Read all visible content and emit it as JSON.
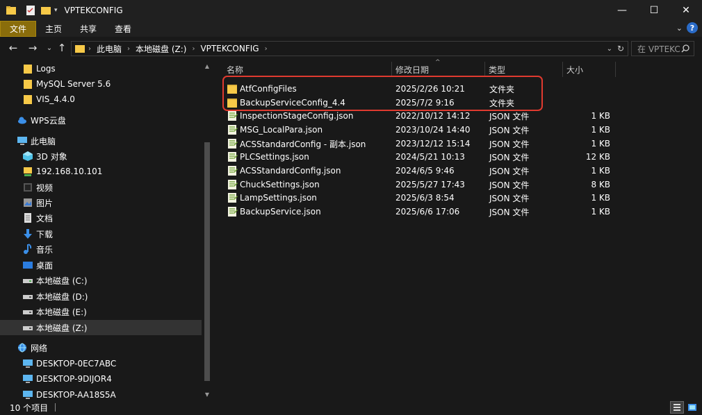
{
  "window": {
    "title": "VPTEKCONFIG",
    "minimize_glyph": "—",
    "maximize_glyph": "☐",
    "close_glyph": "✕"
  },
  "ribbon": {
    "tabs": [
      {
        "label": "文件",
        "active": true
      },
      {
        "label": "主页",
        "active": false
      },
      {
        "label": "共享",
        "active": false
      },
      {
        "label": "查看",
        "active": false
      }
    ],
    "help_glyph": "?"
  },
  "address": {
    "crumbs": [
      "此电脑",
      "本地磁盘 (Z:)",
      "VPTEKCONFIG"
    ],
    "search_placeholder": "在 VPTEKCONFIG 中搜索"
  },
  "sidebar": {
    "items": [
      {
        "label": "Logs",
        "icon": "folder-icon",
        "indent": 1
      },
      {
        "label": "MySQL Server 5.6",
        "icon": "folder-icon",
        "indent": 1
      },
      {
        "label": "VIS_4.4.0",
        "icon": "folder-icon",
        "indent": 1
      },
      {
        "label": "WPS云盘",
        "icon": "cloud-icon",
        "indent": 0
      },
      {
        "label": "此电脑",
        "icon": "pc-icon",
        "indent": 0
      },
      {
        "label": "3D 对象",
        "icon": "cube-icon",
        "indent": 1
      },
      {
        "label": "192.168.10.101",
        "icon": "network-drive-icon",
        "indent": 1
      },
      {
        "label": "视频",
        "icon": "video-icon",
        "indent": 1
      },
      {
        "label": "图片",
        "icon": "picture-icon",
        "indent": 1
      },
      {
        "label": "文档",
        "icon": "document-icon",
        "indent": 1
      },
      {
        "label": "下载",
        "icon": "download-icon",
        "indent": 1
      },
      {
        "label": "音乐",
        "icon": "music-icon",
        "indent": 1
      },
      {
        "label": "桌面",
        "icon": "desktop-icon",
        "indent": 1
      },
      {
        "label": "本地磁盘 (C:)",
        "icon": "drive-icon",
        "indent": 1
      },
      {
        "label": "本地磁盘 (D:)",
        "icon": "drive-icon",
        "indent": 1
      },
      {
        "label": "本地磁盘 (E:)",
        "icon": "drive-icon",
        "indent": 1
      },
      {
        "label": "本地磁盘 (Z:)",
        "icon": "drive-icon",
        "indent": 1,
        "selected": true
      },
      {
        "label": "网络",
        "icon": "network-icon",
        "indent": 0
      },
      {
        "label": "DESKTOP-0EC7ABC",
        "icon": "computer-icon",
        "indent": 1
      },
      {
        "label": "DESKTOP-9DIJOR4",
        "icon": "computer-icon",
        "indent": 1
      },
      {
        "label": "DESKTOP-AA18S5A",
        "icon": "computer-icon",
        "indent": 1
      }
    ]
  },
  "columns": {
    "name": "名称",
    "date": "修改日期",
    "type": "类型",
    "size": "大小"
  },
  "files": [
    {
      "name": "AtfConfigFiles",
      "date": "2025/2/26 10:21",
      "type": "文件夹",
      "size": "",
      "icon": "folder-icon"
    },
    {
      "name": "BackupServiceConfig_4.4",
      "date": "2025/7/2 9:16",
      "type": "文件夹",
      "size": "",
      "icon": "folder-icon"
    },
    {
      "name": "InspectionStageConfig.json",
      "date": "2022/10/12 14:12",
      "type": "JSON 文件",
      "size": "1 KB",
      "icon": "json-file-icon"
    },
    {
      "name": "MSG_LocalPara.json",
      "date": "2023/10/24 14:40",
      "type": "JSON 文件",
      "size": "1 KB",
      "icon": "json-file-icon"
    },
    {
      "name": "ACSStandardConfig - 副本.json",
      "date": "2023/12/12 15:14",
      "type": "JSON 文件",
      "size": "1 KB",
      "icon": "json-file-icon"
    },
    {
      "name": "PLCSettings.json",
      "date": "2024/5/21 10:13",
      "type": "JSON 文件",
      "size": "12 KB",
      "icon": "json-file-icon"
    },
    {
      "name": "ACSStandardConfig.json",
      "date": "2024/6/5 9:46",
      "type": "JSON 文件",
      "size": "1 KB",
      "icon": "json-file-icon"
    },
    {
      "name": "ChuckSettings.json",
      "date": "2025/5/27 17:43",
      "type": "JSON 文件",
      "size": "8 KB",
      "icon": "json-file-icon"
    },
    {
      "name": "LampSettings.json",
      "date": "2025/6/3 8:54",
      "type": "JSON 文件",
      "size": "1 KB",
      "icon": "json-file-icon"
    },
    {
      "name": "BackupService.json",
      "date": "2025/6/6 17:06",
      "type": "JSON 文件",
      "size": "1 KB",
      "icon": "json-file-icon"
    }
  ],
  "status": {
    "item_count": "10 个项目"
  },
  "colors": {
    "accent": "#8a6d0b",
    "folder": "#f7c948",
    "highlight_box": "#e03a2f",
    "background": "#191919"
  }
}
